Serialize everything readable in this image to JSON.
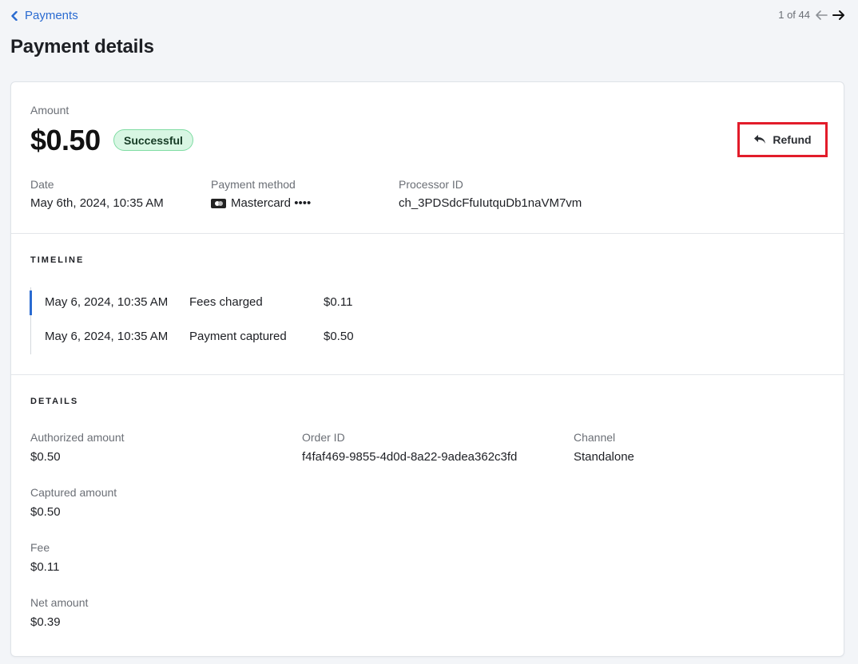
{
  "nav": {
    "back_label": "Payments",
    "pager_text": "1 of 44"
  },
  "page_title": "Payment details",
  "summary": {
    "amount_label": "Amount",
    "amount": "$0.50",
    "status": "Successful",
    "refund_label": "Refund",
    "date_label": "Date",
    "date_value": "May 6th, 2024, 10:35 AM",
    "method_label": "Payment method",
    "method_value": "Mastercard ••••",
    "processor_label": "Processor ID",
    "processor_value": "ch_3PDSdcFfuIutquDb1naVM7vm"
  },
  "timeline": {
    "heading": "TIMELINE",
    "events": [
      {
        "time": "May 6, 2024, 10:35 AM",
        "event": "Fees charged",
        "amount": "$0.11"
      },
      {
        "time": "May 6, 2024, 10:35 AM",
        "event": "Payment captured",
        "amount": "$0.50"
      }
    ]
  },
  "details": {
    "heading": "DETAILS",
    "authorized_label": "Authorized amount",
    "authorized_value": "$0.50",
    "order_label": "Order ID",
    "order_value": "f4faf469-9855-4d0d-8a22-9adea362c3fd",
    "channel_label": "Channel",
    "channel_value": "Standalone",
    "captured_label": "Captured amount",
    "captured_value": "$0.50",
    "fee_label": "Fee",
    "fee_value": "$0.11",
    "net_label": "Net amount",
    "net_value": "$0.39"
  },
  "colors": {
    "accent": "#2a6bd1",
    "success_bg": "#d8f6e3",
    "highlight": "#e21c2a"
  },
  "icons": [
    "chevron-left-icon",
    "arrow-left-icon",
    "arrow-right-icon",
    "reply-icon",
    "mastercard-icon"
  ]
}
